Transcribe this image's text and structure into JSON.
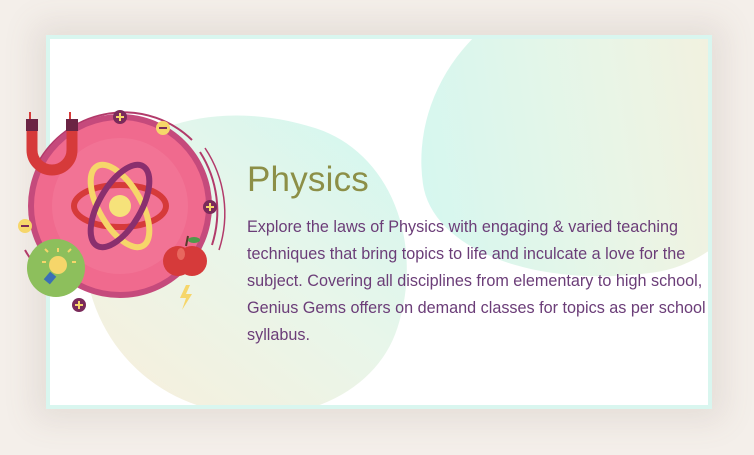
{
  "card": {
    "title": "Physics",
    "description": "Explore the laws of Physics with engaging & varied teaching techniques that bring topics to life and inculcate a love for the subject. Covering all disciplines from elementary to high school, Genius Gems offers on demand classes for topics as per school syllabus."
  },
  "illustration": {
    "icons": [
      "atom-icon",
      "magnet-icon",
      "lightbulb-icon",
      "apple-icon",
      "plus-icon",
      "minus-icon",
      "lightning-icon"
    ]
  },
  "colors": {
    "title": "#8c8f47",
    "text": "#6b3d78",
    "circle": "#f06a8e",
    "accent_red": "#d63a3a",
    "border": "#d9f6ef"
  }
}
